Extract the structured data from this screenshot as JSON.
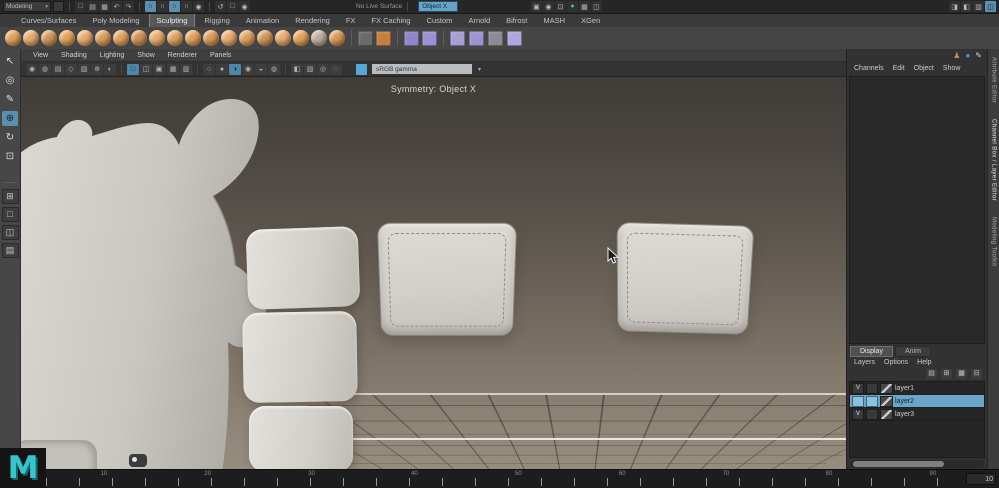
{
  "colors": {
    "accent_blue": "#5b8fae",
    "selection_blue": "#66a3c8",
    "maya_teal": "#3ac3c9",
    "cushion_gray": "#d3d0cb",
    "viewport_top": "#403c38",
    "viewport_bottom": "#978d7e"
  },
  "status_bar": {
    "menu_set": "Modeling",
    "file_icons": [
      {
        "name": "new-scene-icon",
        "glyph": "□"
      },
      {
        "name": "open-scene-icon",
        "glyph": "▤"
      },
      {
        "name": "save-scene-icon",
        "glyph": "▦"
      },
      {
        "name": "undo-icon",
        "glyph": "↶"
      },
      {
        "name": "redo-icon",
        "glyph": "↷"
      }
    ],
    "snap_icons": [
      {
        "name": "snap-to-grid-icon",
        "glyph": "∩",
        "active": true
      },
      {
        "name": "snap-to-curve-icon",
        "glyph": "∩"
      },
      {
        "name": "snap-to-point-icon",
        "glyph": "∩",
        "active": true
      },
      {
        "name": "snap-to-plane-icon",
        "glyph": "∩"
      },
      {
        "name": "make-live-icon",
        "glyph": "◉"
      }
    ],
    "history_icons": [
      {
        "name": "construction-history-icon",
        "glyph": "↺"
      },
      {
        "name": "render-view-icon",
        "glyph": "□"
      },
      {
        "name": "quick-render-icon",
        "glyph": "◉"
      }
    ],
    "live_surface": "No Live Surface",
    "symmetry": "Object X",
    "render_icons": [
      {
        "name": "render-current-frame-icon",
        "glyph": "▣"
      },
      {
        "name": "ipr-render-icon",
        "glyph": "◉"
      },
      {
        "name": "render-sequence-icon",
        "glyph": "⊡"
      },
      {
        "name": "toon-shading-icon",
        "glyph": "●",
        "color": "#46b7bd"
      },
      {
        "name": "render-settings-icon",
        "glyph": "▦"
      },
      {
        "name": "display-layers-icon",
        "glyph": "◫"
      }
    ],
    "sidebar_toggles": [
      {
        "name": "attribute-editor-toggle",
        "glyph": "◨"
      },
      {
        "name": "tool-settings-toggle",
        "glyph": "◧"
      },
      {
        "name": "channel-box-toggle",
        "glyph": "▥"
      },
      {
        "name": "modeling-toolkit-toggle",
        "glyph": "◫",
        "active": true
      }
    ]
  },
  "shelf": {
    "tabs": [
      {
        "label": "Curves/Surfaces"
      },
      {
        "label": "Poly Modeling"
      },
      {
        "label": "Sculpting",
        "active": true
      },
      {
        "label": "Rigging"
      },
      {
        "label": "Animation"
      },
      {
        "label": "Rendering"
      },
      {
        "label": "FX"
      },
      {
        "label": "FX Caching"
      },
      {
        "label": "Custom"
      },
      {
        "label": "Arnold"
      },
      {
        "label": "Bifrost"
      },
      {
        "label": "MASH"
      },
      {
        "label": "XGen"
      }
    ],
    "brushes": [
      {
        "name": "sculpt-brush-icon",
        "color": "#e2a261"
      },
      {
        "name": "smooth-brush-icon",
        "color": "#e8ad72"
      },
      {
        "name": "relax-brush-icon",
        "color": "#d0975e"
      },
      {
        "name": "grab-brush-icon",
        "color": "#e2a261"
      },
      {
        "name": "pinch-brush-icon",
        "color": "#e8ad72"
      },
      {
        "name": "flatten-brush-icon",
        "color": "#dca05f"
      },
      {
        "name": "foamy-brush-icon",
        "color": "#e2a261"
      },
      {
        "name": "spray-brush-icon",
        "color": "#cf9257"
      },
      {
        "name": "repeat-brush-icon",
        "color": "#e8ad72"
      },
      {
        "name": "imprint-brush-icon",
        "color": "#dfa468"
      },
      {
        "name": "wax-brush-icon",
        "color": "#e2a261"
      },
      {
        "name": "scrape-brush-icon",
        "color": "#d89a5c"
      },
      {
        "name": "fill-brush-icon",
        "color": "#e8ad72"
      },
      {
        "name": "knife-brush-icon",
        "color": "#e2a261"
      },
      {
        "name": "smear-brush-icon",
        "color": "#d0975e"
      },
      {
        "name": "bulge-brush-icon",
        "color": "#e8ad72"
      },
      {
        "name": "amplify-brush-icon",
        "color": "#e2a261"
      },
      {
        "name": "freeze-brush-icon",
        "color": "#b9b2a6"
      },
      {
        "name": "convert-frozen-icon",
        "color": "#d89a5c"
      }
    ],
    "mid_icons": [
      {
        "name": "sculpt-falloff-icon",
        "color": "#6b6b6b"
      },
      {
        "name": "stamp-image-icon",
        "color": "#c77f3f"
      }
    ],
    "mask_icons": [
      {
        "name": "mask-brush-icon",
        "color": "#8f86c9"
      },
      {
        "name": "unmask-brush-icon",
        "color": "#9a91d2"
      }
    ],
    "poly_icons": [
      {
        "name": "quad-draw-icon",
        "color": "#a79fd6"
      },
      {
        "name": "multi-cut-icon",
        "color": "#9d94cf"
      },
      {
        "name": "target-weld-icon",
        "color": "#8d8a96"
      },
      {
        "name": "bevel-icon",
        "color": "#b0a8dd"
      }
    ]
  },
  "toolbox": {
    "tools": [
      {
        "name": "select-tool",
        "glyph": "↖"
      },
      {
        "name": "lasso-select-tool",
        "glyph": "◎"
      },
      {
        "name": "paint-select-tool",
        "glyph": "✎"
      },
      {
        "name": "move-tool",
        "glyph": "⊕",
        "active": true
      },
      {
        "name": "rotate-tool",
        "glyph": "↻"
      },
      {
        "name": "scale-tool",
        "glyph": "⊡"
      }
    ],
    "layouts": [
      {
        "name": "layout-four-pane",
        "glyph": "⊞"
      },
      {
        "name": "layout-single-pane",
        "glyph": "□"
      },
      {
        "name": "layout-two-pane",
        "glyph": "◫"
      },
      {
        "name": "layout-outliner-pane",
        "glyph": "▤"
      }
    ]
  },
  "viewport": {
    "menus": [
      {
        "label": "View"
      },
      {
        "label": "Shading"
      },
      {
        "label": "Lighting"
      },
      {
        "label": "Show"
      },
      {
        "label": "Renderer"
      },
      {
        "label": "Panels"
      }
    ],
    "toolbar_group1": [
      {
        "name": "select-camera-icon",
        "glyph": "◉"
      },
      {
        "name": "lock-camera-icon",
        "glyph": "◍"
      },
      {
        "name": "camera-attributes-icon",
        "glyph": "▤"
      },
      {
        "name": "bookmarks-icon",
        "glyph": "◇"
      },
      {
        "name": "image-plane-icon",
        "glyph": "▧"
      },
      {
        "name": "pan-zoom-icon",
        "glyph": "⊕"
      },
      {
        "name": "oversampling-icon",
        "glyph": "◐"
      }
    ],
    "toolbar_group2": [
      {
        "name": "film-gate-icon",
        "glyph": "□",
        "active": true
      },
      {
        "name": "resolution-gate-icon",
        "glyph": "◫"
      },
      {
        "name": "gate-mask-icon",
        "glyph": "▣"
      }
    ],
    "toolbar_group3": [
      {
        "name": "field-chart-icon",
        "glyph": "▦"
      },
      {
        "name": "safe-action-icon",
        "glyph": "▥"
      }
    ],
    "toolbar_group4": [
      {
        "name": "wireframe-icon",
        "glyph": "○"
      },
      {
        "name": "shaded-icon",
        "glyph": "●"
      },
      {
        "name": "textured-icon",
        "glyph": "◑",
        "active": true
      },
      {
        "name": "use-all-lights-icon",
        "glyph": "◉"
      },
      {
        "name": "shadows-icon",
        "glyph": "◒"
      },
      {
        "name": "ambient-occlusion-icon",
        "glyph": "◍"
      }
    ],
    "toolbar_group5": [
      {
        "name": "isolate-select-icon",
        "glyph": "◧"
      },
      {
        "name": "xray-icon",
        "glyph": "▨"
      },
      {
        "name": "wireframe-on-shaded-icon",
        "glyph": "◎"
      },
      {
        "name": "default-material-icon",
        "glyph": "◌"
      }
    ],
    "view_transform": "sRGB gamma",
    "hud": "Symmetry: Object X"
  },
  "channel_box": {
    "top_icons": [
      {
        "name": "character-set-icon",
        "glyph": "♟",
        "color": "#cc8853"
      },
      {
        "name": "sphere-display-icon",
        "glyph": "●",
        "color": "#5a8fd0"
      },
      {
        "name": "pencil-edit-icon",
        "glyph": "✎",
        "color": "#cfcfcf"
      }
    ],
    "menus": [
      {
        "label": "Channels"
      },
      {
        "label": "Edit"
      },
      {
        "label": "Object"
      },
      {
        "label": "Show"
      }
    ]
  },
  "layer_editor": {
    "tabs": [
      {
        "label": "Display",
        "active": true
      },
      {
        "label": "Anim"
      }
    ],
    "menus": [
      {
        "label": "Layers"
      },
      {
        "label": "Options"
      },
      {
        "label": "Help"
      }
    ],
    "icons": [
      {
        "name": "move-layer-up-icon",
        "glyph": "▤"
      },
      {
        "name": "new-empty-layer-icon",
        "glyph": "⊞"
      },
      {
        "name": "new-layer-from-selected-icon",
        "glyph": "▦"
      },
      {
        "name": "delete-layer-icon",
        "glyph": "⊟"
      }
    ],
    "layers": [
      {
        "vis": "V",
        "name": "layer1"
      },
      {
        "vis": "",
        "name": "layer2",
        "selected": true
      },
      {
        "vis": "V",
        "name": "layer3"
      }
    ]
  },
  "side_tabs": [
    {
      "label": "Attribute Editor"
    },
    {
      "label": "Channel Box / Layer Editor",
      "active": true
    },
    {
      "label": "Modeling Toolkit"
    }
  ],
  "timeline": {
    "labels": [
      {
        "pos": "6.3%",
        "text": "10"
      },
      {
        "pos": "17.6%",
        "text": "20"
      },
      {
        "pos": "28.9%",
        "text": "30"
      },
      {
        "pos": "40.1%",
        "text": "40"
      },
      {
        "pos": "51.4%",
        "text": "50"
      },
      {
        "pos": "62.7%",
        "text": "60"
      },
      {
        "pos": "74%",
        "text": "70"
      },
      {
        "pos": "85.2%",
        "text": "80"
      },
      {
        "pos": "96.5%",
        "text": "90"
      }
    ],
    "current_frame": "10"
  },
  "logo": "M"
}
